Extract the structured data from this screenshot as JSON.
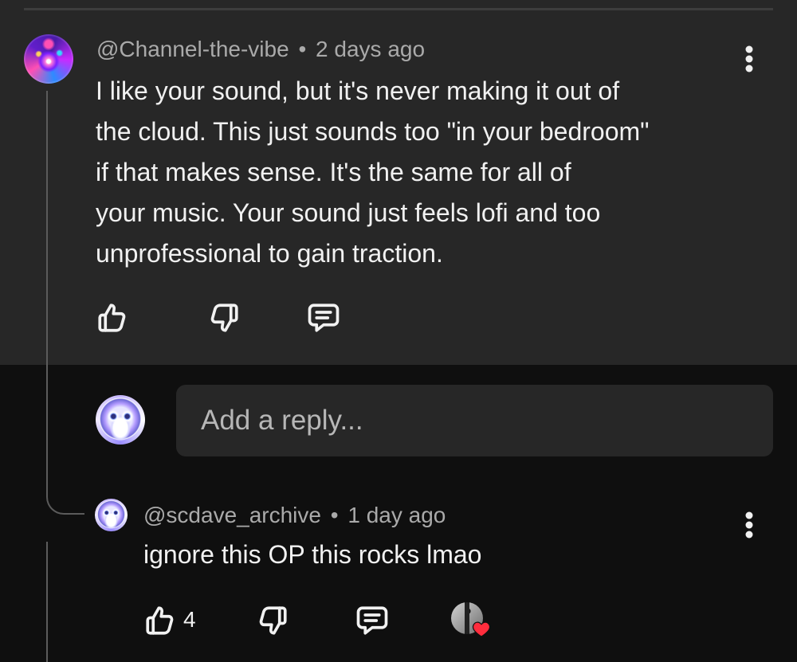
{
  "comment": {
    "author": "@Channel-the-vibe",
    "separator": "•",
    "time": "2 days ago",
    "text": "I like your sound, but it's never making it out of\nthe cloud. This just sounds too \"in your bedroom\"\nif that makes sense. It's the same for all of\nyour music. Your sound just feels lofi and too\nunprofessional to gain traction.",
    "icons": {
      "menu": "more-vertical-icon",
      "like": "thumbs-up-icon",
      "dislike": "thumbs-down-icon",
      "reply": "comment-icon"
    }
  },
  "reply_box": {
    "placeholder": "Add a reply..."
  },
  "reply": {
    "author": "@scdave_archive",
    "separator": "•",
    "time": "1 day ago",
    "text": "ignore this OP this rocks lmao",
    "like_count": "4",
    "icons": {
      "menu": "more-vertical-icon",
      "like": "thumbs-up-icon",
      "dislike": "thumbs-down-icon",
      "reply": "comment-icon",
      "creator_heart": "heart-icon"
    }
  },
  "colors": {
    "background": "#0f0f0f",
    "panel": "#272727",
    "text": "#f1f1f1",
    "muted_text": "#aaaaaa",
    "heart": "#ff2d3d"
  }
}
